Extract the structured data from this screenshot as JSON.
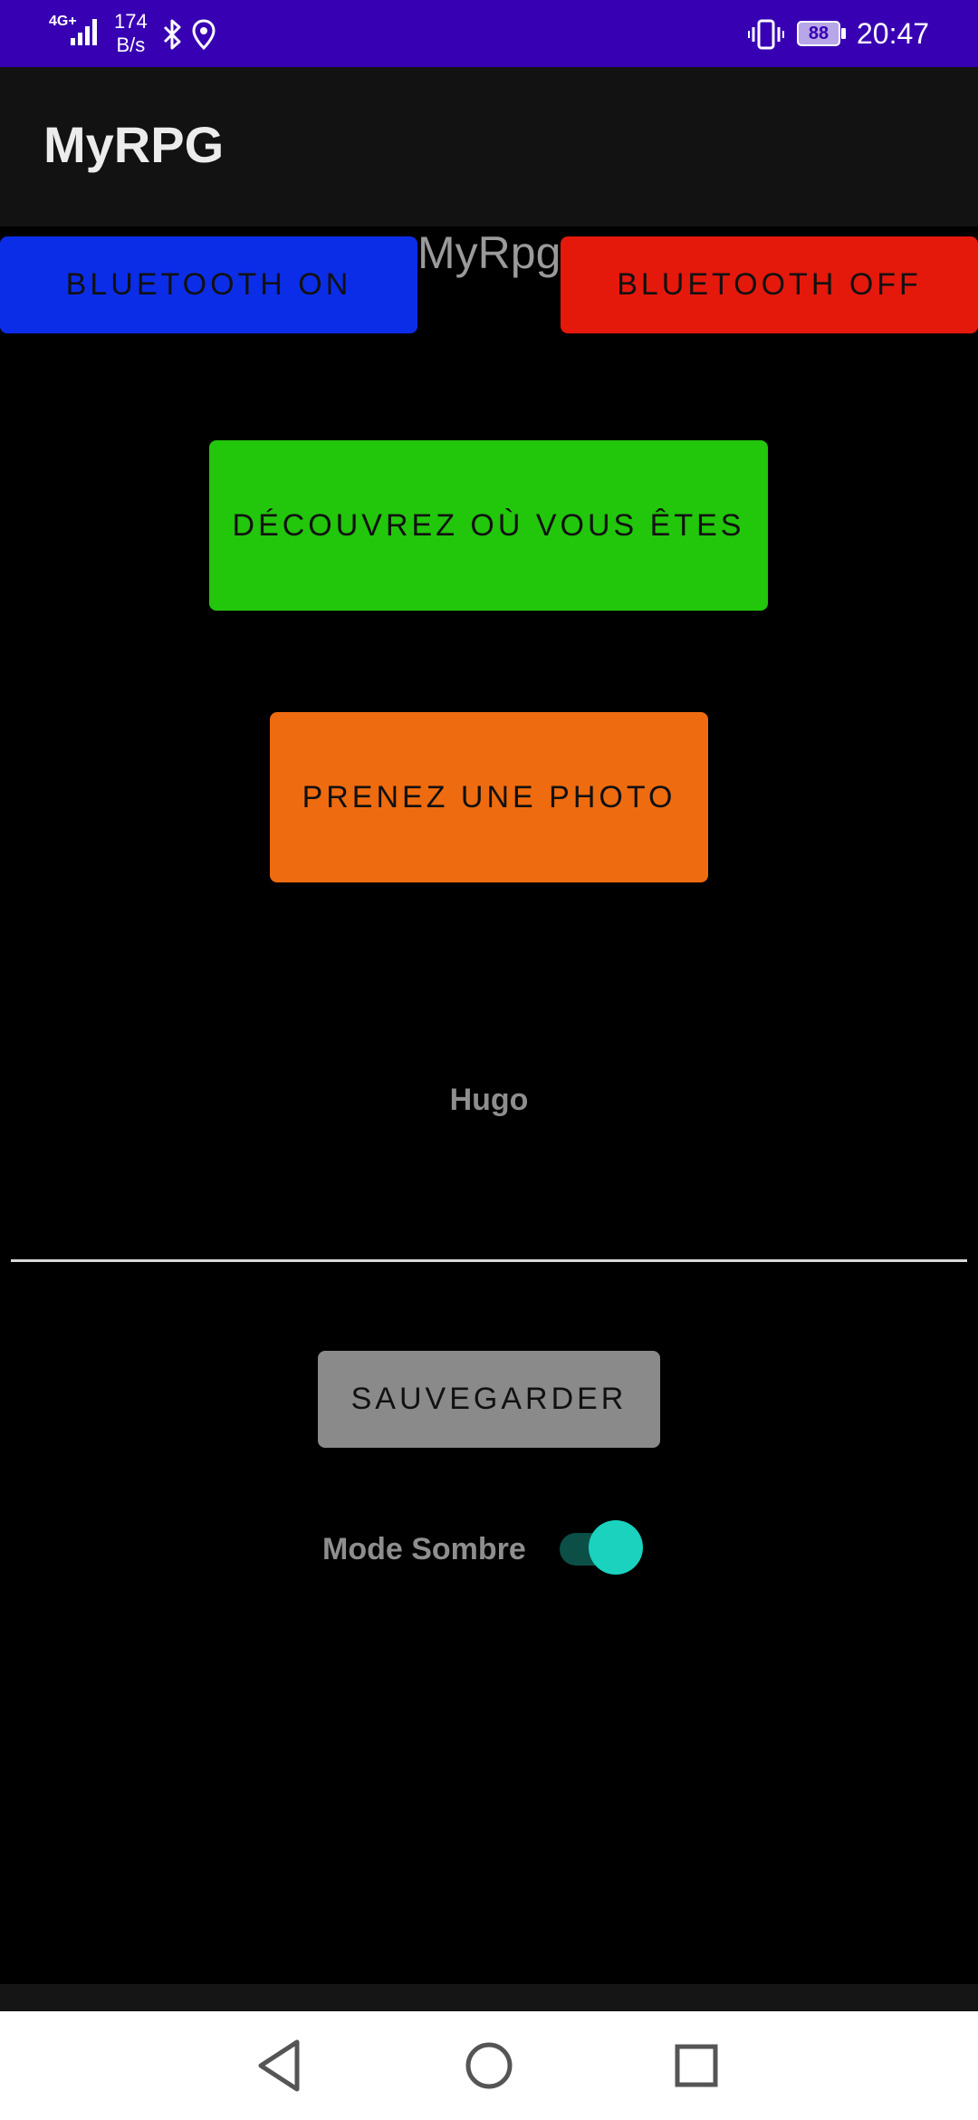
{
  "status_bar": {
    "network": "4G+",
    "speed_value": "174",
    "speed_unit": "B/s",
    "battery": "88",
    "time": "20:47",
    "background_color": "#3700b3"
  },
  "app_bar": {
    "title": "MyRPG"
  },
  "main": {
    "app_label": "MyRpg",
    "bluetooth_on_label": "BLUETOOTH ON",
    "bluetooth_off_label": "BLUETOOTH OFF",
    "locate_label": "DÉCOUVREZ OÙ VOUS ÊTES",
    "photo_label": "PRENEZ UNE PHOTO",
    "player_name": "Hugo",
    "save_label": "SAUVEGARDER",
    "dark_mode_label": "Mode Sombre",
    "dark_mode_enabled": true
  },
  "colors": {
    "bluetooth_on": "#0b2de8",
    "bluetooth_off": "#e5180c",
    "locate": "#22c60b",
    "photo": "#ef6b0f",
    "save": "#8a8a8a",
    "toggle_thumb": "#1ad2be"
  },
  "nav_bar": {
    "icons": [
      "back-icon",
      "home-icon",
      "recents-icon"
    ]
  }
}
